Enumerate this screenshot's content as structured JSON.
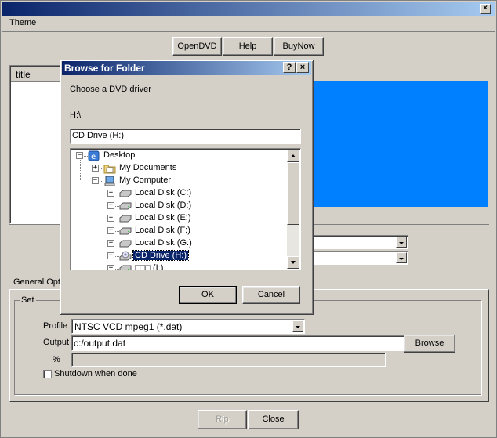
{
  "window": {
    "title": "",
    "close_glyph": "×"
  },
  "menu": {
    "items": [
      "Theme"
    ]
  },
  "toolbar": {
    "open_dvd": "OpenDVD",
    "help": "Help",
    "buy_now": "BuyNow"
  },
  "list": {
    "header": "title"
  },
  "tabs": {
    "general_options": "General Opt"
  },
  "group": {
    "label": "Set",
    "profile_label": "Profile",
    "profile_value": "NTSC VCD mpeg1 (*.dat)",
    "output_label": "Output",
    "output_value": "c:/output.dat",
    "browse": "Browse",
    "percent_label": "%",
    "progress": 0,
    "shutdown_label": "Shutdown when done",
    "shutdown_checked": false
  },
  "bottom": {
    "rip": "Rip",
    "close": "Close"
  },
  "dialog": {
    "title": "Browse for Folder",
    "help_glyph": "?",
    "close_glyph": "×",
    "instruction": "Choose a DVD driver",
    "path": "H:\\",
    "selected_folder": "CD Drive (H:)",
    "ok": "OK",
    "cancel": "Cancel",
    "tree": [
      {
        "label": "Desktop",
        "icon": "desktop-icon",
        "expander": "−"
      },
      {
        "label": "My Documents",
        "icon": "folder-icon",
        "expander": "+"
      },
      {
        "label": "My Computer",
        "icon": "computer-icon",
        "expander": "−"
      },
      {
        "label": "Local Disk (C:)",
        "icon": "disk-drive-icon",
        "expander": "+"
      },
      {
        "label": "Local Disk (D:)",
        "icon": "disk-drive-icon",
        "expander": "+"
      },
      {
        "label": "Local Disk (E:)",
        "icon": "disk-drive-icon",
        "expander": "+"
      },
      {
        "label": "Local Disk (F:)",
        "icon": "disk-drive-icon",
        "expander": "+"
      },
      {
        "label": "Local Disk (G:)",
        "icon": "disk-drive-icon",
        "expander": "+"
      },
      {
        "label": "CD Drive (H:)",
        "icon": "cd-drive-icon",
        "expander": "+",
        "selected": true
      },
      {
        "label": "□□□ (I:)",
        "icon": "disk-drive-icon",
        "expander": "+"
      }
    ]
  },
  "colors": {
    "title_start": "#0a246a",
    "title_end": "#a6caf0",
    "preview_blue": "#0080ff",
    "selection": "#0a246a",
    "face": "#d4d0c8"
  }
}
